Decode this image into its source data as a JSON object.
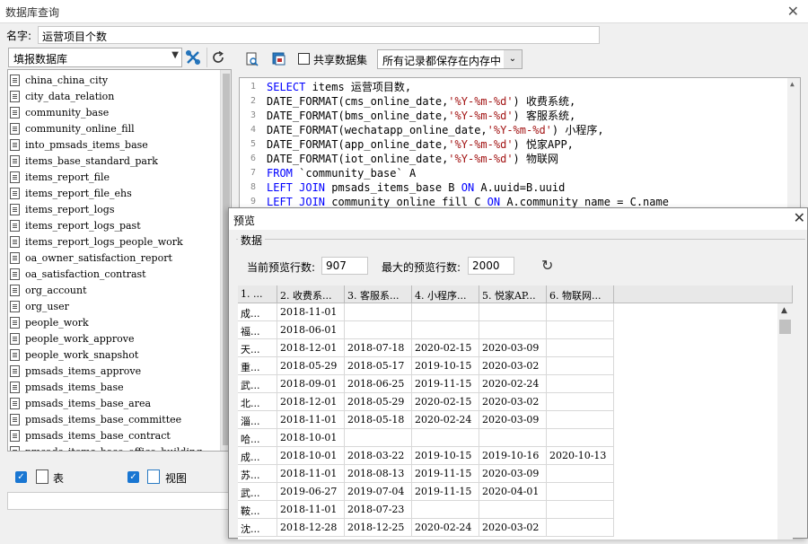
{
  "window": {
    "title": "数据库查询",
    "close_glyph": "✕"
  },
  "name_row": {
    "label": "名字:",
    "value": "运营项目个数"
  },
  "left_panel": {
    "datasource": "填报数据库",
    "datasource_arrow": "▼",
    "tables": [
      "china_china_city",
      "city_data_relation",
      "community_base",
      "community_online_fill",
      "into_pmsads_items_base",
      "items_base_standard_park",
      "items_report_file",
      "items_report_file_ehs",
      "items_report_logs",
      "items_report_logs_past",
      "items_report_logs_people_work",
      "oa_owner_satisfaction_report",
      "oa_satisfaction_contrast",
      "org_account",
      "org_user",
      "people_work",
      "people_work_approve",
      "people_work_snapshot",
      "pmsads_items_approve",
      "pmsads_items_base",
      "pmsads_items_base_area",
      "pmsads_items_base_committee",
      "pmsads_items_base_contract",
      "pmsads_items_base_office_building"
    ],
    "check_table_label": "表",
    "check_view_label": "视图",
    "check_glyph": "✓"
  },
  "editor_toolbar": {
    "share_label": "共享数据集",
    "memory_option": "所有记录都保存在内存中",
    "arrow": "⌄"
  },
  "sql_lines": [
    {
      "n": "1",
      "parts": [
        {
          "t": "SELECT",
          "c": "kw"
        },
        {
          "t": " items 运营项目数,",
          "c": ""
        }
      ]
    },
    {
      "n": "2",
      "parts": [
        {
          "t": "DATE_FORMAT(cms_online_date,",
          "c": ""
        },
        {
          "t": "'%Y-%m-%d'",
          "c": "str"
        },
        {
          "t": ") 收费系统,",
          "c": ""
        }
      ]
    },
    {
      "n": "3",
      "parts": [
        {
          "t": "DATE_FORMAT(bms_online_date,",
          "c": ""
        },
        {
          "t": "'%Y-%m-%d'",
          "c": "str"
        },
        {
          "t": ") 客服系统,",
          "c": ""
        }
      ]
    },
    {
      "n": "4",
      "parts": [
        {
          "t": "DATE_FORMAT(wechatapp_online_date,",
          "c": ""
        },
        {
          "t": "'%Y-%m-%d'",
          "c": "str"
        },
        {
          "t": ") 小程序,",
          "c": ""
        }
      ]
    },
    {
      "n": "5",
      "parts": [
        {
          "t": "DATE_FORMAT(app_online_date,",
          "c": ""
        },
        {
          "t": "'%Y-%m-%d'",
          "c": "str"
        },
        {
          "t": ") 悦家APP,",
          "c": ""
        }
      ]
    },
    {
      "n": "6",
      "parts": [
        {
          "t": "DATE_FORMAT(iot_online_date,",
          "c": ""
        },
        {
          "t": "'%Y-%m-%d'",
          "c": "str"
        },
        {
          "t": ") 物联网",
          "c": ""
        }
      ]
    },
    {
      "n": "7",
      "parts": [
        {
          "t": "FROM",
          "c": "kw"
        },
        {
          "t": " `community_base` A",
          "c": ""
        }
      ]
    },
    {
      "n": "8",
      "parts": [
        {
          "t": "LEFT JOIN",
          "c": "kw"
        },
        {
          "t": " pmsads_items_base B ",
          "c": ""
        },
        {
          "t": "ON",
          "c": "kw"
        },
        {
          "t": " A.uuid=B.uuid",
          "c": ""
        }
      ]
    },
    {
      "n": "9",
      "parts": [
        {
          "t": "LEFT JOIN",
          "c": "kw"
        },
        {
          "t": " community_online_fill C ",
          "c": ""
        },
        {
          "t": "ON",
          "c": "kw"
        },
        {
          "t": " A.community_name = C.name",
          "c": ""
        }
      ]
    }
  ],
  "preview": {
    "title": "预览",
    "close_glyph": "✕",
    "group_label": "数据",
    "current_rows_label": "当前预览行数:",
    "current_rows_value": "907",
    "max_rows_label": "最大的预览行数:",
    "max_rows_value": "2000",
    "refresh_glyph": "↻",
    "columns": [
      "1. ...",
      "2. 收费系...",
      "3. 客服系...",
      "4. 小程序...",
      "5. 悦家AP...",
      "6. 物联网..."
    ],
    "rows": [
      [
        "成...",
        "2018-11-01",
        "",
        "",
        "",
        ""
      ],
      [
        "福...",
        "2018-06-01",
        "",
        "",
        "",
        ""
      ],
      [
        "天...",
        "2018-12-01",
        "2018-07-18",
        "2020-02-15",
        "2020-03-09",
        ""
      ],
      [
        "重...",
        "2018-05-29",
        "2018-05-17",
        "2019-10-15",
        "2020-03-02",
        ""
      ],
      [
        "武...",
        "2018-09-01",
        "2018-06-25",
        "2019-11-15",
        "2020-02-24",
        ""
      ],
      [
        "北...",
        "2018-12-01",
        "2018-05-29",
        "2020-02-15",
        "2020-03-02",
        ""
      ],
      [
        "淄...",
        "2018-11-01",
        "2018-05-18",
        "2020-02-24",
        "2020-03-09",
        ""
      ],
      [
        "哈...",
        "2018-10-01",
        "",
        "",
        "",
        ""
      ],
      [
        "成...",
        "2018-10-01",
        "2018-03-22",
        "2019-10-15",
        "2019-10-16",
        "2020-10-13"
      ],
      [
        "苏...",
        "2018-11-01",
        "2018-08-13",
        "2019-11-15",
        "2020-03-09",
        ""
      ],
      [
        "武...",
        "2019-06-27",
        "2019-07-04",
        "2019-11-15",
        "2020-04-01",
        ""
      ],
      [
        "鞍...",
        "2018-11-01",
        "2018-07-23",
        "",
        "",
        ""
      ],
      [
        "沈...",
        "2018-12-28",
        "2018-12-25",
        "2020-02-24",
        "2020-03-02",
        ""
      ]
    ]
  },
  "colors": {
    "keyword": "#0000ff",
    "string": "#a31515",
    "accent": "#1976d2"
  }
}
